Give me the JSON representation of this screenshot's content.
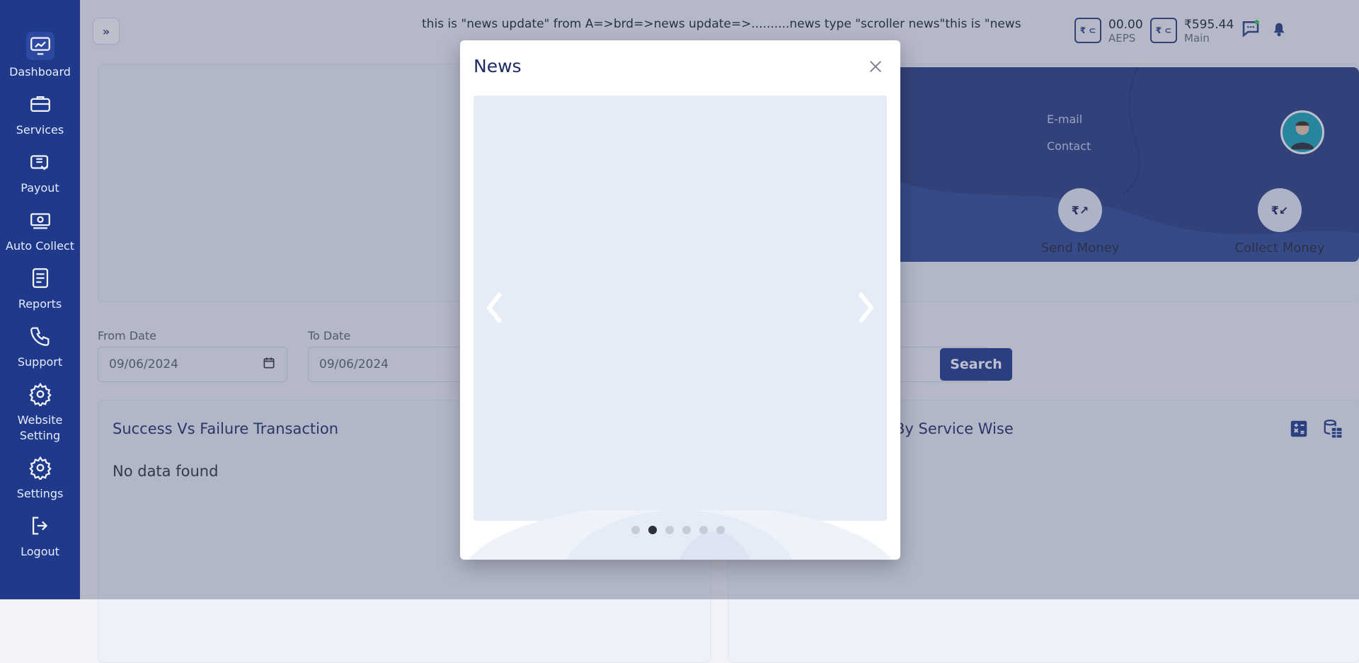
{
  "sidebar": {
    "items": [
      {
        "label": "Dashboard",
        "icon": "dashboard-icon",
        "active": true
      },
      {
        "label": "Services",
        "icon": "services-icon"
      },
      {
        "label": "Payout",
        "icon": "payout-icon"
      },
      {
        "label": "Auto Collect",
        "icon": "auto-collect-icon"
      },
      {
        "label": "Reports",
        "icon": "reports-icon"
      },
      {
        "label": "Support",
        "icon": "support-icon"
      },
      {
        "label": "Website Setting",
        "icon": "website-setting-icon"
      },
      {
        "label": "Settings",
        "icon": "settings-icon"
      },
      {
        "label": "Logout",
        "icon": "logout-icon"
      }
    ]
  },
  "header": {
    "ticker_text": "this is \"news update\" from A=>brd=>news update=>..........news type \"scroller news\"this is \"news",
    "aeps": {
      "amount": "00.00",
      "label": "AEPS"
    },
    "main": {
      "amount": "₹595.44",
      "label": "Main"
    }
  },
  "profile": {
    "email_label": "E-mail",
    "contact_label": "Contact",
    "actions": [
      {
        "label": "Send Money"
      },
      {
        "label": "Collect Money"
      }
    ]
  },
  "filters": {
    "from_date_label": "From Date",
    "from_date_value": "09/06/2024",
    "to_date_label": "To Date",
    "to_date_value": "09/06/2024",
    "search_label": "Search"
  },
  "cards": {
    "left_title": "Success Vs Failure Transaction",
    "left_empty": "No data found",
    "right_title_fragment": "By Service Wise"
  },
  "modal": {
    "title": "News",
    "carousel_dots": 6,
    "active_dot_index": 1
  },
  "colors": {
    "brand": "#1f3a8a",
    "modal_title": "#1e2b66",
    "carousel_bg": "#e5ebf7",
    "overlay": "rgba(65,75,110,.35)"
  }
}
